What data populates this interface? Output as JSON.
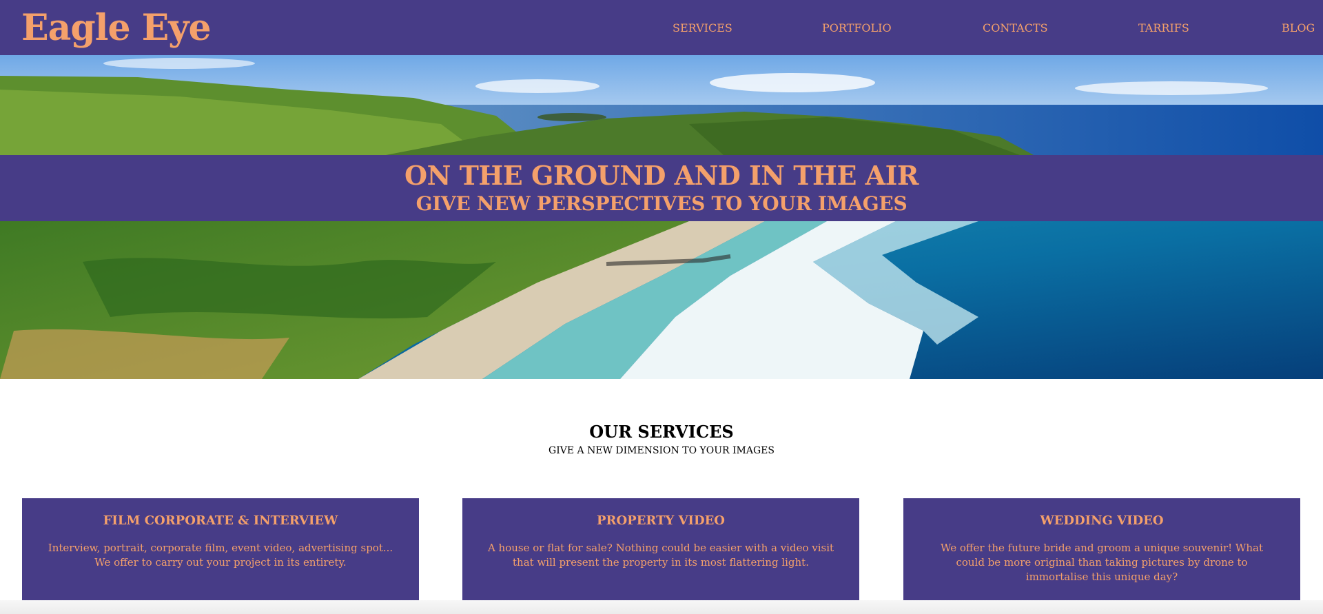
{
  "colors": {
    "brand": "#473c87",
    "accent": "#f4a06b",
    "text_dark": "#000000",
    "background": "#ffffff"
  },
  "header": {
    "logo": "Eagle Eye",
    "nav": [
      "SERVICES",
      "PORTFOLIO",
      "CONTACTS",
      "TARRIFS",
      "BLOG"
    ]
  },
  "hero": {
    "image": "aerial-coastline-photo",
    "title": "ON THE GROUND AND IN THE AIR",
    "subtitle": "GIVE NEW PERSPECTIVES TO YOUR IMAGES"
  },
  "services": {
    "title": "OUR SERVICES",
    "subtitle": "GIVE A NEW DIMENSION TO YOUR IMAGES",
    "cards": [
      {
        "title": "FILM CORPORATE & INTERVIEW",
        "text": "Interview, portrait, corporate film, event video, advertising spot... We offer to carry out your project in its entirety."
      },
      {
        "title": "PROPERTY VIDEO",
        "text": "A house or flat for sale? Nothing could be easier with a video visit that will present the property in its most flattering light."
      },
      {
        "title": "WEDDING VIDEO",
        "text": "We offer the future bride and groom a unique souvenir! What could be more original than taking pictures by drone to immortalise this unique day?"
      }
    ]
  }
}
